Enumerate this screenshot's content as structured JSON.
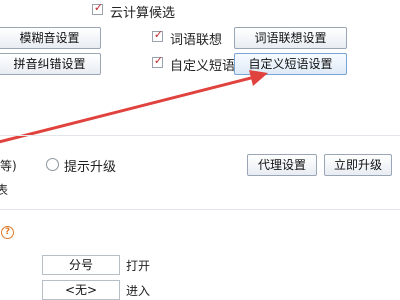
{
  "options": {
    "cloud_candidates": {
      "label": "云计算候选",
      "checked": true
    },
    "word_association": {
      "label": "词语联想",
      "checked": true
    },
    "custom_phrase": {
      "label": "自定义短语",
      "checked": true
    }
  },
  "buttons": {
    "fuzzy_sound": "模糊音设置",
    "pinyin_correction": "拼音纠错设置",
    "word_association_settings": "词语联想设置",
    "custom_phrase_settings": "自定义短语设置",
    "proxy_settings": "代理设置",
    "upgrade_now": "立即升级"
  },
  "update": {
    "partial_label": "等)",
    "prompt_upgrade_label": "提示升级",
    "left_char": "表"
  },
  "hotkeys": [
    {
      "key": "分号",
      "action": "打开"
    },
    {
      "key": "<无>",
      "action": "进入"
    }
  ],
  "colors": {
    "arrow": "#e0433d",
    "check": "#c1272d",
    "help": "#e07a2c"
  }
}
